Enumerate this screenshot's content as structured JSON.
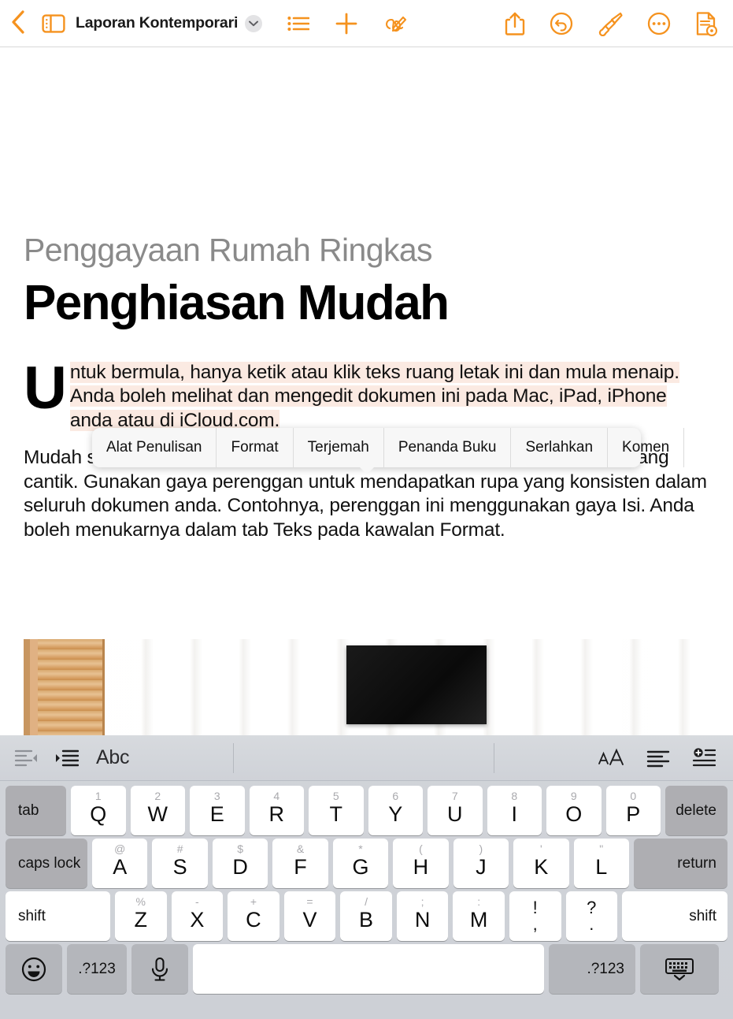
{
  "toolbar": {
    "back_icon": "chevron-left-icon",
    "sidebar_icon": "sidebar-toggle-icon",
    "title": "Laporan Kontemporari",
    "title_chevron": "chevron-down-icon",
    "list_icon": "bullet-list-icon",
    "add_icon": "plus-icon",
    "draw_icon": "scribble-pencil-icon",
    "share_icon": "share-icon",
    "undo_icon": "undo-icon",
    "format_icon": "paintbrush-icon",
    "more_icon": "ellipsis-circle-icon",
    "view_icon": "document-view-icon",
    "accent_color": "#F5921E"
  },
  "document": {
    "eyebrow": "Penggayaan Rumah Ringkas",
    "headline": "Penghiasan Mudah",
    "paragraph1_dropcap": "U",
    "paragraph1": "ntuk bermula, hanya ketik atau klik teks ruang letak ini dan mula menaip. Anda boleh melihat dan mengedit dokumen ini pada Mac, iPad, iPhone anda atau di iCloud.com.",
    "paragraph2": "Mudah sahaja untuk mengedit teks, menukar fon dan menambah grafik yang cantik. Gunakan gaya perenggan untuk mendapatkan rupa yang konsisten dalam seluruh dokumen anda. Contohnya, perenggan ini menggunakan gaya Isi. Anda boleh menukarnya dalam tab Teks pada kawalan Format.",
    "highlight_color": "#fbeae2",
    "image_alt": "photo-interior-wall-art"
  },
  "context_menu": {
    "items": [
      {
        "label": "Alat Penulisan"
      },
      {
        "label": "Format"
      },
      {
        "label": "Terjemah"
      },
      {
        "label": "Penanda Buku"
      },
      {
        "label": "Serlahkan"
      },
      {
        "label": "Komen"
      }
    ]
  },
  "keyboard_toolbar": {
    "outdent_icon": "outdent-icon",
    "indent_icon": "indent-icon",
    "abc_label": "Abc",
    "text_size_icon": "text-size-icon",
    "align_icon": "text-align-icon",
    "insert_icon": "insert-item-icon"
  },
  "keyboard": {
    "row1": [
      {
        "label": "tab",
        "type": "mod-gray",
        "width": "k-tab"
      },
      {
        "label": "Q",
        "sec": "1"
      },
      {
        "label": "W",
        "sec": "2"
      },
      {
        "label": "E",
        "sec": "3"
      },
      {
        "label": "R",
        "sec": "4"
      },
      {
        "label": "T",
        "sec": "5"
      },
      {
        "label": "Y",
        "sec": "6"
      },
      {
        "label": "U",
        "sec": "7"
      },
      {
        "label": "I",
        "sec": "8"
      },
      {
        "label": "O",
        "sec": "9"
      },
      {
        "label": "P",
        "sec": "0"
      },
      {
        "label": "delete",
        "type": "mod-gray",
        "width": "k-delete"
      }
    ],
    "row2": [
      {
        "label": "caps lock",
        "type": "mod-gray",
        "width": "k-caps"
      },
      {
        "label": "A",
        "sec": "@"
      },
      {
        "label": "S",
        "sec": "#"
      },
      {
        "label": "D",
        "sec": "$"
      },
      {
        "label": "F",
        "sec": "&"
      },
      {
        "label": "G",
        "sec": "*"
      },
      {
        "label": "H",
        "sec": "("
      },
      {
        "label": "J",
        "sec": ")"
      },
      {
        "label": "K",
        "sec": "'"
      },
      {
        "label": "L",
        "sec": "\""
      },
      {
        "label": "return",
        "type": "mod-gray",
        "width": "k-return"
      }
    ],
    "row3": [
      {
        "label": "shift",
        "type": "mod-white",
        "width": "k-shift-l"
      },
      {
        "label": "Z",
        "sec": "%"
      },
      {
        "label": "X",
        "sec": "-"
      },
      {
        "label": "C",
        "sec": "+"
      },
      {
        "label": "V",
        "sec": "="
      },
      {
        "label": "B",
        "sec": "/"
      },
      {
        "label": "N",
        "sec": ";"
      },
      {
        "label": "M",
        "sec": ":"
      },
      {
        "label": ",",
        "up": "!",
        "dn": ",",
        "dual": true
      },
      {
        "label": ".",
        "up": "?",
        "dn": ".",
        "dual": true
      },
      {
        "label": "shift",
        "type": "mod-white",
        "width": "k-shift-r"
      }
    ],
    "row4": [
      {
        "label": "emoji-icon",
        "type": "icon-gray",
        "width": "k-emoji"
      },
      {
        "label": ".?123",
        "type": "mod-gray",
        "width": "k-num"
      },
      {
        "label": "microphone-icon",
        "type": "icon-gray",
        "width": "k-mic"
      },
      {
        "label": "",
        "type": "space",
        "width": "k-space"
      },
      {
        "label": ".?123",
        "type": "mod-gray",
        "width": "k-num2"
      },
      {
        "label": "dismiss-keyboard-icon",
        "type": "icon-gray",
        "width": "k-dismiss"
      }
    ]
  }
}
